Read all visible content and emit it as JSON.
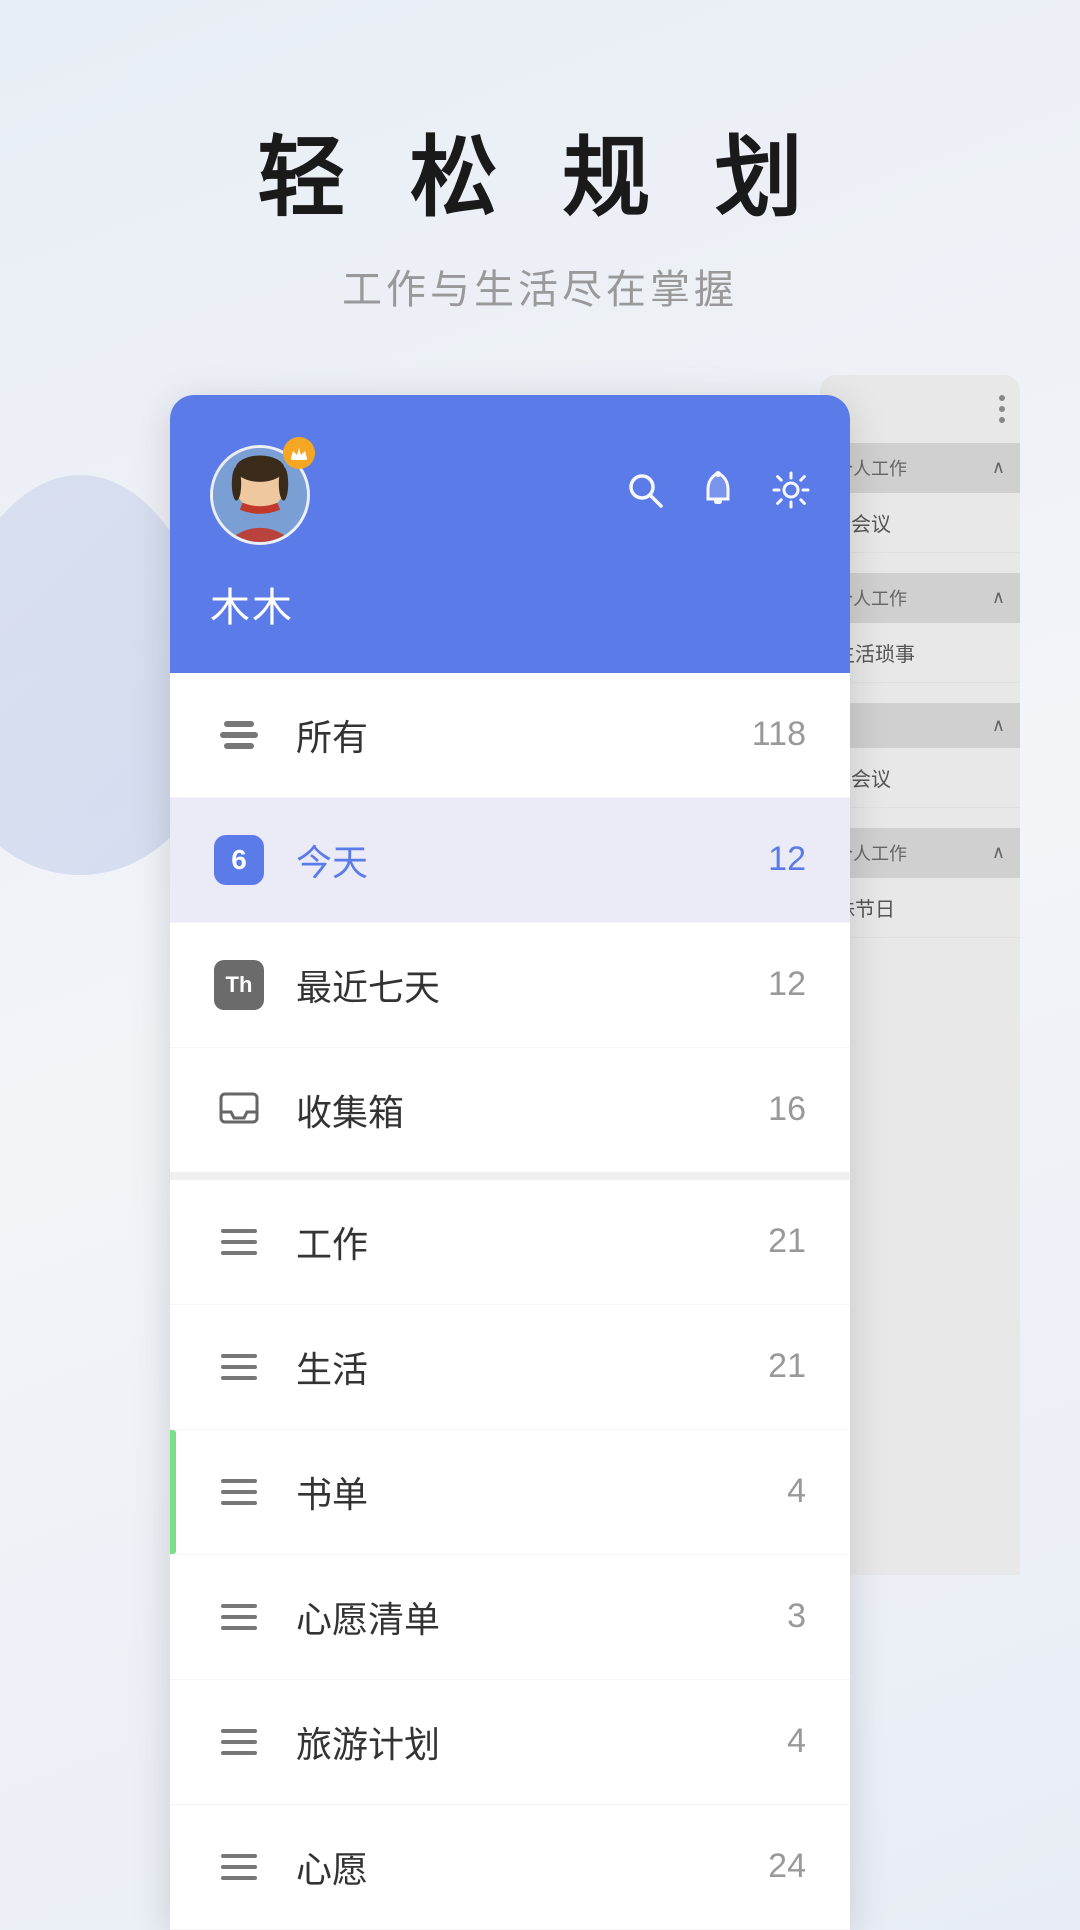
{
  "hero": {
    "title": "轻 松 规 划",
    "subtitle": "工作与生活尽在掌握"
  },
  "header": {
    "username": "木木",
    "icons": {
      "search": "🔍",
      "bell": "🔔",
      "settings": "⚙️"
    },
    "crown": "👑"
  },
  "menu_items": [
    {
      "id": "all",
      "icon_type": "stack",
      "label": "所有",
      "count": "118",
      "active": false
    },
    {
      "id": "today",
      "icon_type": "calendar_today",
      "label": "今天",
      "count": "12",
      "active": true
    },
    {
      "id": "week",
      "icon_type": "calendar_th",
      "label": "最近七天",
      "count": "12",
      "active": false
    },
    {
      "id": "inbox",
      "icon_type": "inbox",
      "label": "收集箱",
      "count": "16",
      "active": false
    },
    {
      "id": "work",
      "icon_type": "lines",
      "label": "工作",
      "count": "21",
      "active": false
    },
    {
      "id": "life",
      "icon_type": "lines",
      "label": "生活",
      "count": "21",
      "active": false
    },
    {
      "id": "books",
      "icon_type": "lines",
      "label": "书单",
      "count": "4",
      "active": false,
      "accent": true
    },
    {
      "id": "wishes",
      "icon_type": "lines",
      "label": "心愿清单",
      "count": "3",
      "active": false
    },
    {
      "id": "travel",
      "icon_type": "lines",
      "label": "旅游计划",
      "count": "4",
      "active": false
    },
    {
      "id": "mind",
      "icon_type": "lines",
      "label": "心愿",
      "count": "24",
      "active": false
    }
  ],
  "right_panel": {
    "sections": [
      {
        "header": "个人工作",
        "rows": [
          "会议"
        ]
      },
      {
        "header": "个人工作",
        "rows": [
          "生活琐事"
        ]
      },
      {
        "header": "",
        "rows": [
          "会议"
        ]
      },
      {
        "header": "个人工作",
        "rows": [
          "殊节日"
        ]
      }
    ]
  }
}
